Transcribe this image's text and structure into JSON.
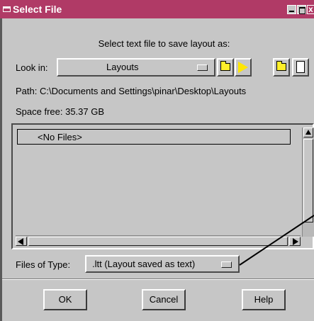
{
  "window": {
    "title": "Select File",
    "minimize_icon": "minimize-icon",
    "maximize_icon": "maximize-icon",
    "close_icon": "close-icon",
    "close_glyph": "x"
  },
  "prompt": "Select text file to save layout as:",
  "lookin": {
    "label": "Look in:",
    "value": "Layouts",
    "icons": [
      "folder-up-icon",
      "go-arrow-icon",
      "new-folder-icon",
      "new-file-icon"
    ]
  },
  "path_line": "Path: C:\\Documents and Settings\\pinar\\Desktop\\Layouts",
  "space_line": "Space free:  35.37 GB",
  "file_list": {
    "items": [
      "<No Files>"
    ]
  },
  "filetype": {
    "label": "Files of Type:",
    "value": ".ltt (Layout saved as text)"
  },
  "buttons": {
    "ok": "OK",
    "cancel": "Cancel",
    "help": "Help"
  },
  "colors": {
    "titlebar": "#b03a66",
    "dialog_bg": "#c6c6c6"
  }
}
